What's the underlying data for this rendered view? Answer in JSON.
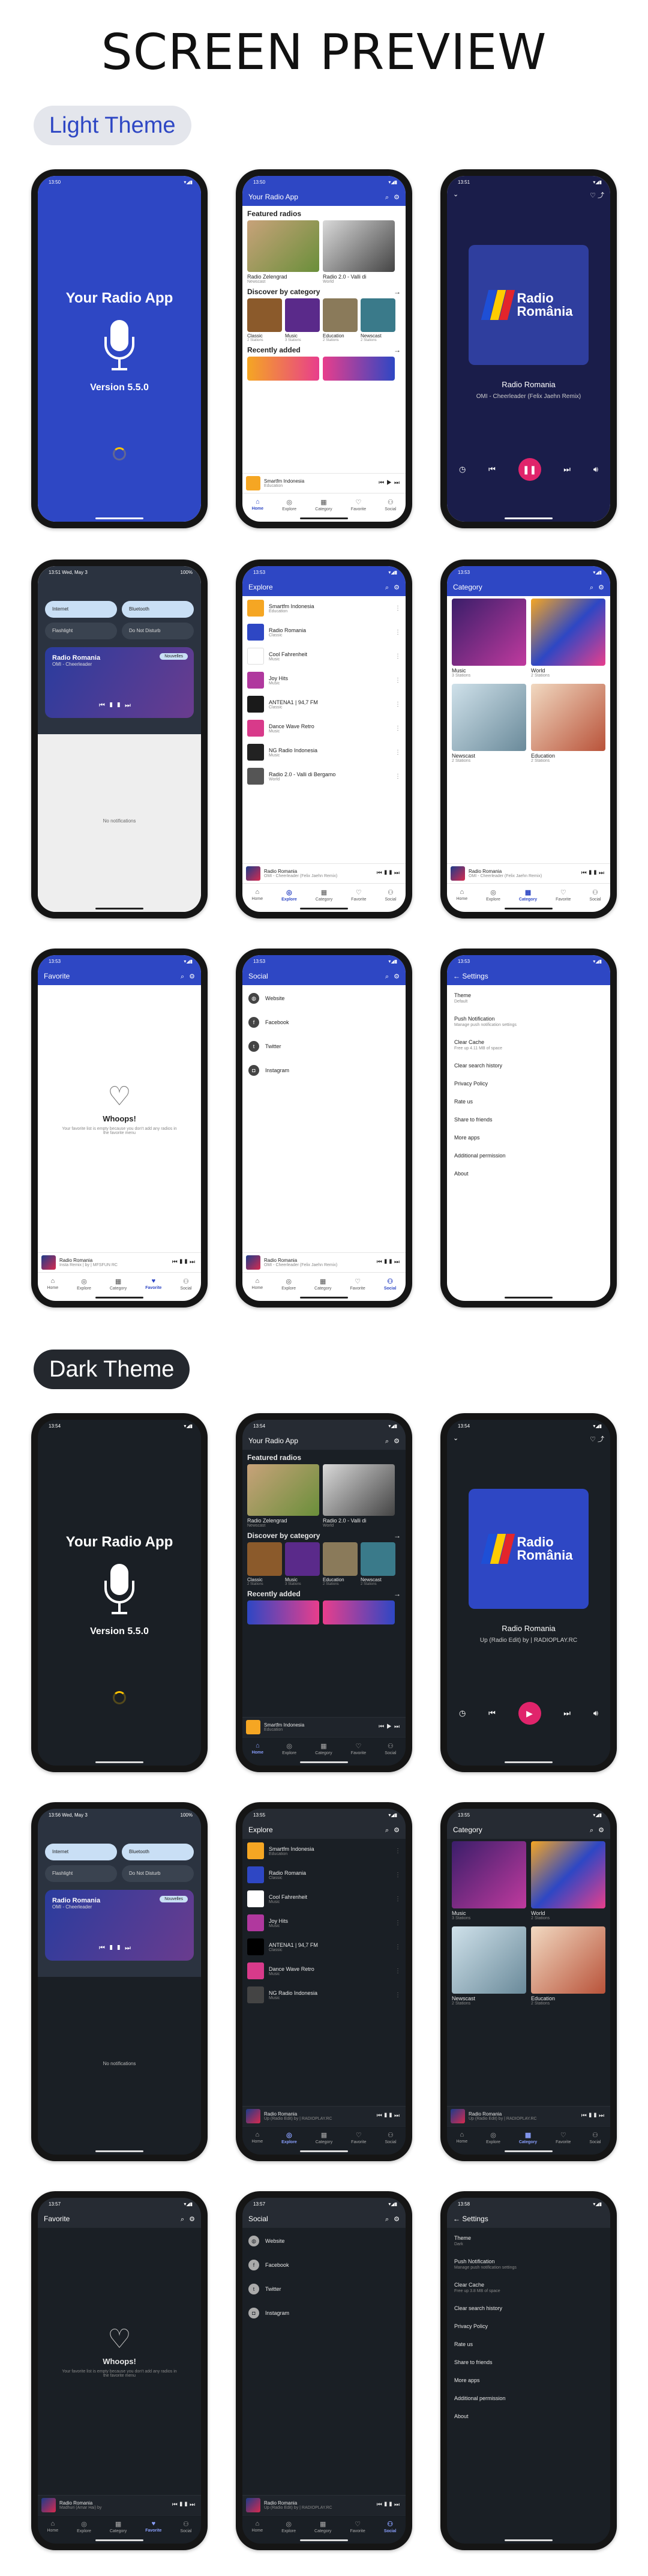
{
  "page": {
    "title": "SCREEN PREVIEW",
    "light_label": "Light Theme",
    "dark_label": "Dark Theme"
  },
  "splash": {
    "title": "Your Radio App",
    "version": "Version 5.5.0"
  },
  "home": {
    "title": "Your Radio App",
    "featured": "Featured radios",
    "discover": "Discover by category",
    "recent": "Recently added",
    "featured_items": [
      {
        "name": "Radio Zelengrad",
        "cat": "Newscast"
      },
      {
        "name": "Radio 2.0 - Valli di",
        "cat": "World"
      }
    ],
    "categories": [
      {
        "name": "Classic",
        "count": "2 Stations"
      },
      {
        "name": "Music",
        "count": "3 Stations"
      },
      {
        "name": "Education",
        "count": "2 Stations"
      },
      {
        "name": "Newscast",
        "count": "2 Stations"
      }
    ]
  },
  "nav": {
    "home": "Home",
    "explore": "Explore",
    "category": "Category",
    "favorite": "Favorite",
    "social": "Social"
  },
  "mini": {
    "name": "Radio Romania",
    "song_light": "OMI - Cheerleader (Felix Jaehn Remix)",
    "song_dark": "Up (Radio Edit) by | RADIOPLAY.RC",
    "home_name": "Smartfm Indonesia",
    "home_cat": "Education",
    "fav_song_light": "Insta Remix | by | MFSFUN RC",
    "fav_song_dark": "Madhuri (Amar Hai) by"
  },
  "player": {
    "station": "Radio Romania",
    "song_light": "OMI - Cheerleader (Felix Jaehn Remix)",
    "song_dark": "Up (Radio Edit) by | RADIOPLAY.RC",
    "logo1": "Radio",
    "logo2": "România"
  },
  "shade": {
    "time_light": "13:51 Wed, May 3",
    "time_dark": "13:56 Wed, May 3",
    "battery": "100%",
    "tiles": [
      "Internet",
      "Bluetooth",
      "Flashlight",
      "Do Not Disturb"
    ],
    "card_title": "Radio Romania",
    "card_sub": "OMI - Cheerleader",
    "card_btn": "Nouvelles",
    "no_notif": "No notifications"
  },
  "explore": {
    "title": "Explore",
    "items": [
      {
        "name": "Smartfm Indonesia",
        "cat": "Education"
      },
      {
        "name": "Radio Romania",
        "cat": "Classic"
      },
      {
        "name": "Cool Fahrenheit",
        "cat": "Music"
      },
      {
        "name": "Joy Hits",
        "cat": "Music"
      },
      {
        "name": "ANTENA1 | 94,7 FM",
        "cat": "Classic"
      },
      {
        "name": "Dance Wave Retro",
        "cat": "Music"
      },
      {
        "name": "NG Radio Indonesia",
        "cat": "Music"
      },
      {
        "name": "Radio 2.0 - Valli di Bergamo",
        "cat": "World"
      }
    ]
  },
  "category": {
    "title": "Category",
    "items": [
      {
        "name": "Music",
        "count": "3 Stations"
      },
      {
        "name": "World",
        "count": "2 Stations"
      },
      {
        "name": "Newscast",
        "count": "2 Stations"
      },
      {
        "name": "Education",
        "count": "2 Stations"
      }
    ]
  },
  "favorite": {
    "title": "Favorite",
    "whoops": "Whoops!",
    "message": "Your favorite list is empty because you don't add any radios in the favorite menu"
  },
  "social": {
    "title": "Social",
    "items": [
      "Website",
      "Facebook",
      "Twitter",
      "Instagram"
    ]
  },
  "settings": {
    "title": "Settings",
    "theme": "Theme",
    "theme_light": "Default",
    "theme_dark": "Dark",
    "push": "Push Notification",
    "push_sub": "Manage push notification settings",
    "cache": "Clear Cache",
    "cache_light": "Free up 4.11 MB of space",
    "cache_dark": "Free up 3.8 MB of space",
    "search": "Clear search history",
    "privacy": "Privacy Policy",
    "rate": "Rate us",
    "share": "Share to friends",
    "more": "More apps",
    "additional": "Additional permission",
    "about": "About"
  },
  "times": {
    "a": "13:50",
    "b": "13:50",
    "c": "13:51",
    "d": "13:53",
    "e": "13:53",
    "f": "13:53",
    "g": "13:53",
    "h": "13:53",
    "i": "13:54",
    "j": "13:54",
    "k": "13:54",
    "l": "13:55",
    "m": "13:55",
    "n": "13:57",
    "o": "13:57",
    "p": "13:57",
    "q": "13:58"
  }
}
